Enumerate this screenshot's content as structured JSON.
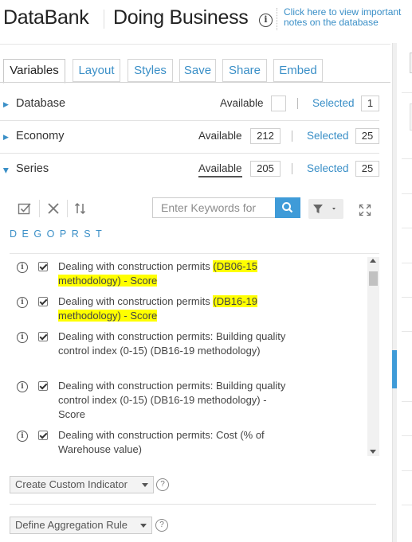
{
  "header": {
    "brand": "DataBank",
    "database_title": "Doing Business",
    "note_link": "Click here to view important notes on the database"
  },
  "tabs": [
    "Variables",
    "Layout",
    "Styles",
    "Save",
    "Share",
    "Embed"
  ],
  "sections": [
    {
      "name": "Database",
      "available_label": "Available",
      "available": "",
      "selected_label": "Selected",
      "selected": "1"
    },
    {
      "name": "Economy",
      "available_label": "Available",
      "available": "212",
      "selected_label": "Selected",
      "selected": "25"
    },
    {
      "name": "Series",
      "available_label": "Available",
      "available": "205",
      "selected_label": "Selected",
      "selected": "25"
    }
  ],
  "toolbar": {
    "search_placeholder": "Enter Keywords for",
    "letters": [
      "D",
      "E",
      "G",
      "O",
      "P",
      "R",
      "S",
      "T"
    ]
  },
  "series_items": [
    {
      "pre": "Dealing with construction permits ",
      "hl": "(DB06-15 methodology) - Score",
      "post": "",
      "checked": true
    },
    {
      "pre": "Dealing with construction permits ",
      "hl": "(DB16-19 methodology) - Score",
      "post": "",
      "checked": true
    },
    {
      "pre": "Dealing with construction permits: Building quality control index (0-15) (DB16-19 methodology)",
      "hl": "",
      "post": "",
      "checked": true
    },
    {
      "pre": "Dealing with construction permits: Building quality control index (0-15) (DB16-19 methodology) - Score",
      "hl": "",
      "post": "",
      "checked": true
    },
    {
      "pre": "Dealing with construction permits: Cost (% of Warehouse value)",
      "hl": "",
      "post": "",
      "checked": true
    }
  ],
  "actions": {
    "custom_indicator": "Create Custom Indicator",
    "aggregation_rule": "Define Aggregation Rule"
  },
  "colors": {
    "accent": "#3f9bd8",
    "link": "#3a8fc7",
    "highlight": "#ffff00"
  }
}
